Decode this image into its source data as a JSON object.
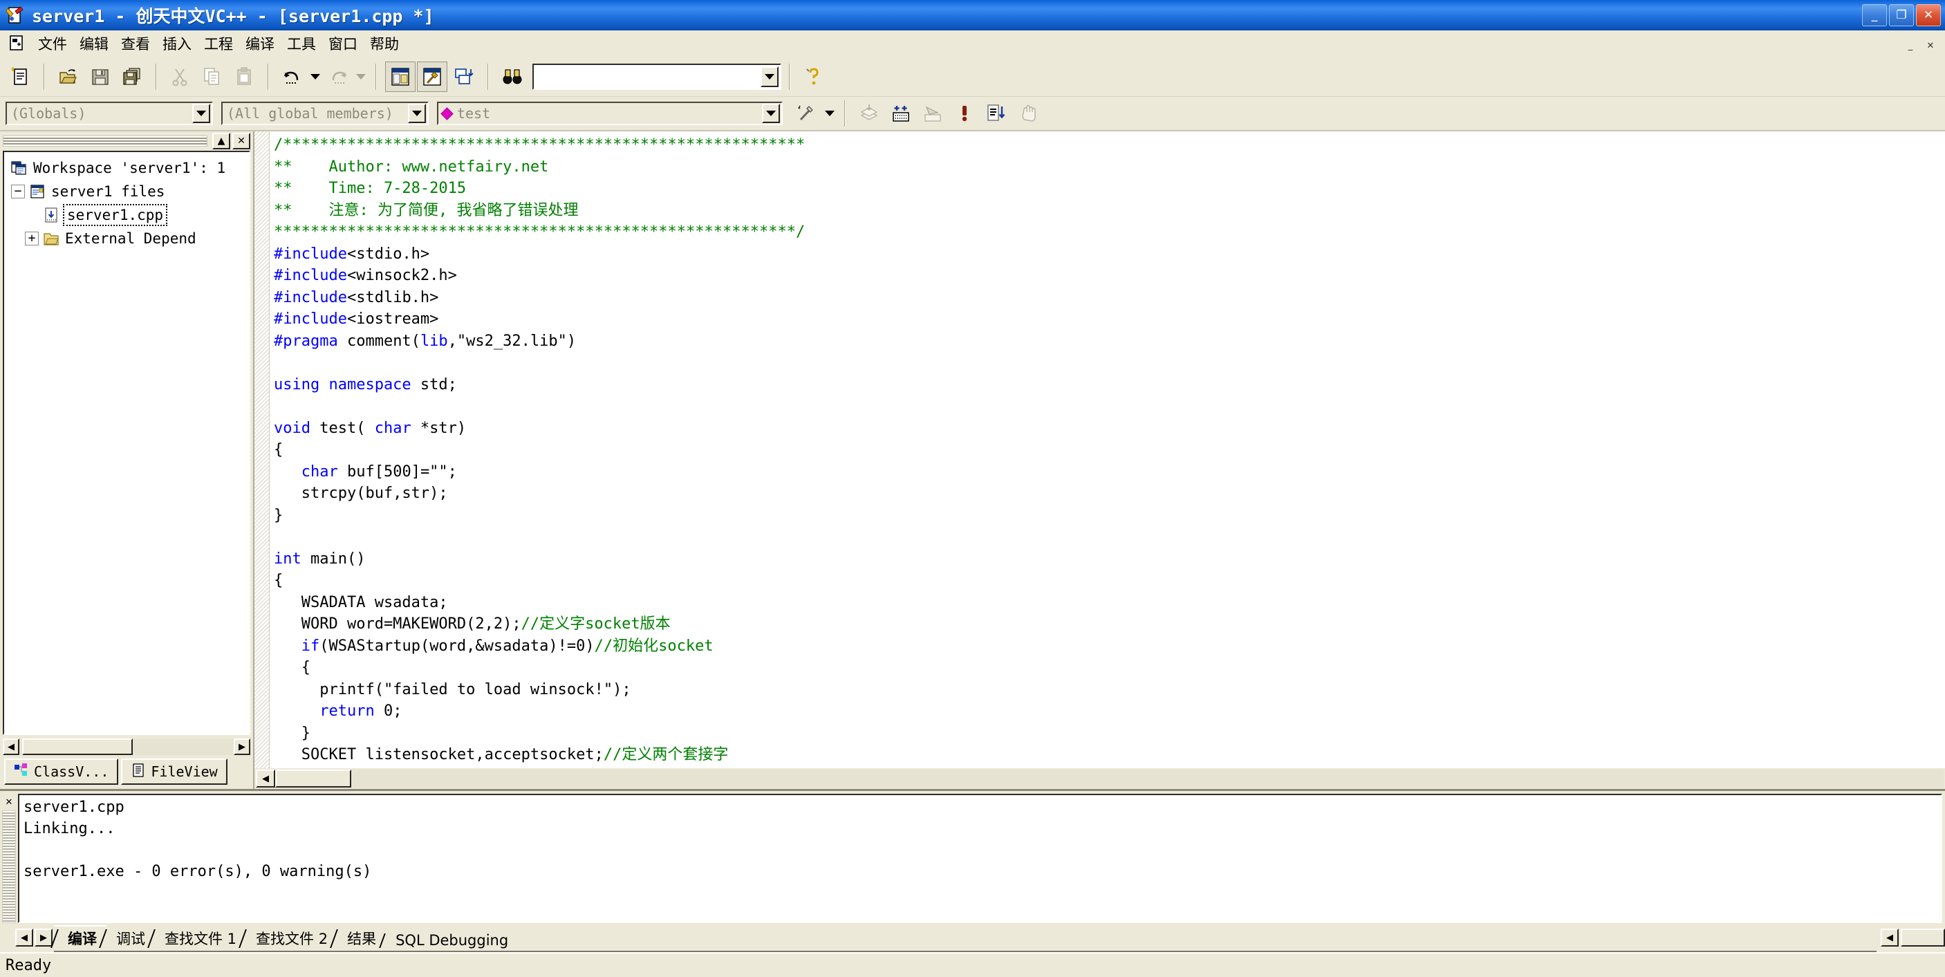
{
  "window": {
    "title": "server1 - 创天中文VC++ - [server1.cpp *]",
    "minimize": "_",
    "restore": "❐",
    "close": "✕",
    "mdi_minimize": "_",
    "mdi_restore": "❐",
    "mdi_close": "✕"
  },
  "menu": {
    "items": [
      {
        "label": "文件"
      },
      {
        "label": "编辑"
      },
      {
        "label": "查看"
      },
      {
        "label": "插入"
      },
      {
        "label": "工程"
      },
      {
        "label": "编译"
      },
      {
        "label": "工具"
      },
      {
        "label": "窗口"
      },
      {
        "label": "帮助"
      }
    ]
  },
  "toolbar_standard": {
    "buttons": [
      {
        "name": "new-text-file",
        "icon": "new-file-icon"
      },
      {
        "name": "open",
        "icon": "open-folder-icon"
      },
      {
        "name": "save",
        "icon": "save-disk-icon"
      },
      {
        "name": "save-all",
        "icon": "save-all-icon"
      },
      {
        "name": "cut",
        "icon": "scissors-icon"
      },
      {
        "name": "copy",
        "icon": "copy-icon"
      },
      {
        "name": "paste",
        "icon": "clipboard-icon"
      },
      {
        "name": "undo",
        "icon": "undo-arrow-icon"
      },
      {
        "name": "redo",
        "icon": "redo-arrow-icon"
      },
      {
        "name": "workspace-toggle",
        "icon": "workspace-window-icon"
      },
      {
        "name": "output-toggle",
        "icon": "output-window-icon"
      },
      {
        "name": "windows-list",
        "icon": "window-stack-icon"
      },
      {
        "name": "find-in-files",
        "icon": "binoculars-icon"
      }
    ],
    "find_box_value": "",
    "find_box_placeholder": "",
    "help_icon": "question-mark-icon"
  },
  "toolbar_wizardbar": {
    "class_combo": "(Globals)",
    "member_combo": "(All global members)",
    "function_combo": "test",
    "function_icon": "member-diamond-icon",
    "action_icon": "wand-icon",
    "buttons": [
      {
        "name": "compile",
        "icon": "compile-icon"
      },
      {
        "name": "build",
        "icon": "build-icon"
      },
      {
        "name": "stop-build",
        "icon": "stop-build-icon"
      },
      {
        "name": "go",
        "icon": "exclamation-icon"
      },
      {
        "name": "insert-breakpoint",
        "icon": "breakpoint-list-icon"
      },
      {
        "name": "hand",
        "icon": "hand-icon"
      }
    ]
  },
  "workspace": {
    "title_gripper": "",
    "minimize_label": "▲",
    "close_label": "✕",
    "tree": [
      {
        "label": "Workspace 'server1': 1",
        "icon": "workspace-icon",
        "indent": 0,
        "expander": "",
        "selected": false
      },
      {
        "label": "server1 files",
        "icon": "project-icon",
        "indent": 1,
        "expander": "−",
        "selected": false
      },
      {
        "label": "server1.cpp",
        "icon": "cpp-file-icon",
        "indent": 2,
        "expander": "",
        "selected": true
      },
      {
        "label": "External Depend",
        "icon": "folder-icon",
        "indent": 2,
        "expander": "+",
        "selected": false
      }
    ],
    "hscroll_left": "◀",
    "hscroll_right": "▶",
    "tabs": [
      {
        "label": "ClassV...",
        "icon": "classview-icon",
        "active": false
      },
      {
        "label": "FileView",
        "icon": "fileview-icon",
        "active": true
      }
    ]
  },
  "editor": {
    "filename": "server1.cpp",
    "scroll_left": "◀",
    "scroll_right": "▶",
    "lines": [
      [
        {
          "t": "/*********************************************************",
          "s": "c"
        }
      ],
      [
        {
          "t": "**    Author: www.netfairy.net",
          "s": "c"
        }
      ],
      [
        {
          "t": "**    Time: 7-28-2015",
          "s": "c"
        }
      ],
      [
        {
          "t": "**    注意: 为了简便, 我省略了错误处理",
          "s": "c"
        }
      ],
      [
        {
          "t": "*********************************************************/",
          "s": "c"
        }
      ],
      [
        {
          "t": "#include",
          "s": "k"
        },
        {
          "t": "<stdio.h>",
          "s": "n"
        }
      ],
      [
        {
          "t": "#include",
          "s": "k"
        },
        {
          "t": "<winsock2.h>",
          "s": "n"
        }
      ],
      [
        {
          "t": "#include",
          "s": "k"
        },
        {
          "t": "<stdlib.h>",
          "s": "n"
        }
      ],
      [
        {
          "t": "#include",
          "s": "k"
        },
        {
          "t": "<iostream>",
          "s": "n"
        }
      ],
      [
        {
          "t": "#pragma",
          "s": "k"
        },
        {
          "t": " comment(",
          "s": "n"
        },
        {
          "t": "lib",
          "s": "k"
        },
        {
          "t": ",\"ws2_32.lib\")",
          "s": "n"
        }
      ],
      [
        {
          "t": "",
          "s": "n"
        }
      ],
      [
        {
          "t": "using namespace",
          "s": "k"
        },
        {
          "t": " std;",
          "s": "n"
        }
      ],
      [
        {
          "t": "",
          "s": "n"
        }
      ],
      [
        {
          "t": "void",
          "s": "k"
        },
        {
          "t": " test( ",
          "s": "n"
        },
        {
          "t": "char",
          "s": "k"
        },
        {
          "t": " *str)",
          "s": "n"
        }
      ],
      [
        {
          "t": "{",
          "s": "n"
        }
      ],
      [
        {
          "t": "   ",
          "s": "n"
        },
        {
          "t": "char",
          "s": "k"
        },
        {
          "t": " buf[500]=\"\";",
          "s": "n"
        }
      ],
      [
        {
          "t": "   strcpy(buf,str);",
          "s": "n"
        }
      ],
      [
        {
          "t": "}",
          "s": "n"
        }
      ],
      [
        {
          "t": "",
          "s": "n"
        }
      ],
      [
        {
          "t": "int",
          "s": "k"
        },
        {
          "t": " main()",
          "s": "n"
        }
      ],
      [
        {
          "t": "{",
          "s": "n"
        }
      ],
      [
        {
          "t": "   WSADATA wsadata;",
          "s": "n"
        }
      ],
      [
        {
          "t": "   WORD word=MAKEWORD(2,2);",
          "s": "n"
        },
        {
          "t": "//定义字socket版本",
          "s": "c"
        }
      ],
      [
        {
          "t": "   ",
          "s": "n"
        },
        {
          "t": "if",
          "s": "k"
        },
        {
          "t": "(WSAStartup(word,&wsadata)!=0)",
          "s": "n"
        },
        {
          "t": "//初始化socket",
          "s": "c"
        }
      ],
      [
        {
          "t": "   {",
          "s": "n"
        }
      ],
      [
        {
          "t": "     printf(\"failed to load winsock!\");",
          "s": "n"
        }
      ],
      [
        {
          "t": "     ",
          "s": "n"
        },
        {
          "t": "return",
          "s": "k"
        },
        {
          "t": " 0;",
          "s": "n"
        }
      ],
      [
        {
          "t": "   }",
          "s": "n"
        }
      ],
      [
        {
          "t": "   SOCKET listensocket,acceptsocket;",
          "s": "n"
        },
        {
          "t": "//定义两个套接字",
          "s": "c"
        }
      ]
    ]
  },
  "output": {
    "close_label": "✕",
    "text": "server1.cpp\nLinking...\n\nserver1.exe - 0 error(s), 0 warning(s)",
    "nav_left": "◀",
    "nav_right": "▶",
    "tabs": [
      {
        "label": "编译",
        "active": true
      },
      {
        "label": "调试",
        "active": false
      },
      {
        "label": "查找文件 1",
        "active": false
      },
      {
        "label": "查找文件 2",
        "active": false
      },
      {
        "label": "结果",
        "active": false
      },
      {
        "label": "SQL Debugging",
        "active": false
      }
    ]
  },
  "statusbar": {
    "message": "Ready"
  },
  "colors": {
    "title_blue": "#1d6ddb",
    "face": "#ece9d8",
    "keyword": "#0000ff",
    "comment": "#008000",
    "text": "#000000",
    "editor_bg": "#ffffff"
  }
}
